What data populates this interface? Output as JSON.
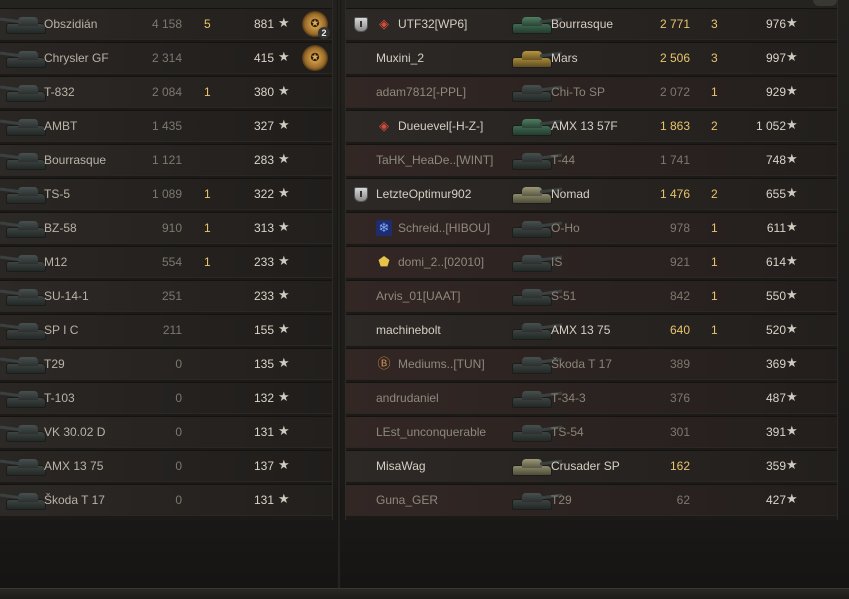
{
  "left_team": [
    {
      "tank": "Obszidián",
      "damage": "4 158",
      "frags": "5",
      "xp": "881",
      "medal": {
        "count": "2"
      }
    },
    {
      "tank": "Chrysler GF",
      "damage": "2 314",
      "frags": "",
      "xp": "415",
      "medal": {
        "count": ""
      }
    },
    {
      "tank": "T-832",
      "damage": "2 084",
      "frags": "1",
      "xp": "380"
    },
    {
      "tank": "AMBT",
      "damage": "1 435",
      "frags": "",
      "xp": "327"
    },
    {
      "tank": "Bourrasque",
      "damage": "1 121",
      "frags": "",
      "xp": "283"
    },
    {
      "tank": "TS-5",
      "damage": "1 089",
      "frags": "1",
      "xp": "322"
    },
    {
      "tank": "BZ-58",
      "damage": "910",
      "frags": "1",
      "xp": "313"
    },
    {
      "tank": "M12",
      "damage": "554",
      "frags": "1",
      "xp": "233"
    },
    {
      "tank": "SU-14-1",
      "damage": "251",
      "frags": "",
      "xp": "233"
    },
    {
      "tank": "SP I C",
      "damage": "211",
      "frags": "",
      "xp": "155"
    },
    {
      "tank": "T29",
      "damage": "0",
      "frags": "",
      "xp": "135"
    },
    {
      "tank": "T-103",
      "damage": "0",
      "frags": "",
      "xp": "132"
    },
    {
      "tank": "VK 30.02 D",
      "damage": "0",
      "frags": "",
      "xp": "131"
    },
    {
      "tank": "AMX 13 75",
      "damage": "0",
      "frags": "",
      "xp": "137"
    },
    {
      "tank": "Škoda T 17",
      "damage": "0",
      "frags": "",
      "xp": "131"
    }
  ],
  "right_team": [
    {
      "player": "UTF32[WP6]",
      "tank": "Bourrasque",
      "damage": "2 771",
      "frags": "3",
      "xp": "976",
      "platoon": true,
      "clan_icon": "diamond-icon",
      "alive": true
    },
    {
      "player": "Muxini_2",
      "tank": "Mars",
      "damage": "2 506",
      "frags": "3",
      "xp": "997",
      "alive": true
    },
    {
      "player": "adam7812[-PPL]",
      "tank": "Chi-To SP",
      "damage": "2 072",
      "frags": "1",
      "xp": "929",
      "alive": false
    },
    {
      "player": "Dueuevel[-H-Z-]",
      "tank": "AMX 13 57F",
      "damage": "1 863",
      "frags": "2",
      "xp": "1 052",
      "clan_icon": "diamond-icon",
      "alive": true
    },
    {
      "player": "TaHK_HeaDe..[WINT]",
      "tank": "T-44",
      "damage": "1 741",
      "frags": "",
      "xp": "748",
      "alive": false
    },
    {
      "player": "LetzteOptimur902",
      "tank": "Nomad",
      "damage": "1 476",
      "frags": "2",
      "xp": "655",
      "platoon": true,
      "alive": true
    },
    {
      "player": "Schreid..[HIBOU]",
      "tank": "O-Ho",
      "damage": "978",
      "frags": "1",
      "xp": "611",
      "clan_icon": "snowflake-icon",
      "alive": false
    },
    {
      "player": "domi_2..[02010]",
      "tank": "IS",
      "damage": "921",
      "frags": "1",
      "xp": "614",
      "clan_icon": "badge-icon",
      "alive": false
    },
    {
      "player": "Arvis_01[UAAT]",
      "tank": "S-51",
      "damage": "842",
      "frags": "1",
      "xp": "550",
      "alive": false
    },
    {
      "player": "machinebolt",
      "tank": "AMX 13 75",
      "damage": "640",
      "frags": "1",
      "xp": "520",
      "alive": true
    },
    {
      "player": "Mediums..[TUN]",
      "tank": "Škoda T 17",
      "damage": "389",
      "frags": "",
      "xp": "369",
      "clan_icon": "medal-icon",
      "alive": false
    },
    {
      "player": "andrudaniel",
      "tank": "T-34-3",
      "damage": "376",
      "frags": "",
      "xp": "487",
      "alive": false
    },
    {
      "player": "LEst_unconquerable",
      "tank": "TS-54",
      "damage": "301",
      "frags": "",
      "xp": "391",
      "alive": false
    },
    {
      "player": "MisaWag",
      "tank": "Crusader SP",
      "damage": "162",
      "frags": "",
      "xp": "359",
      "alive": true
    },
    {
      "player": "Guna_GER",
      "tank": "T29",
      "damage": "62",
      "frags": "",
      "xp": "427",
      "alive": false
    }
  ],
  "star_glyph": "★"
}
